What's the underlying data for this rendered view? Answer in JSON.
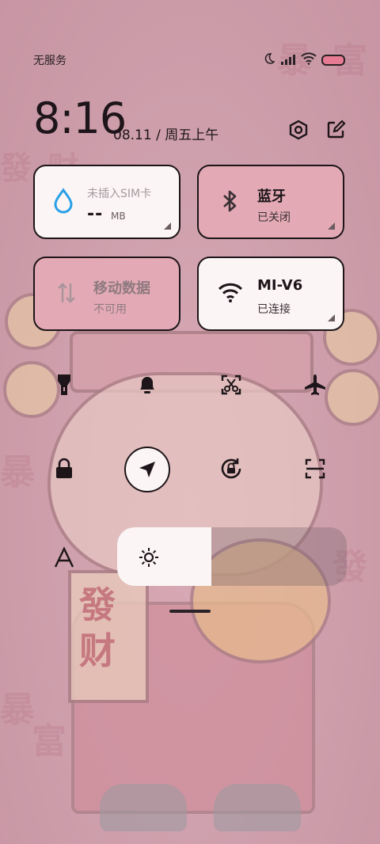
{
  "status_bar": {
    "carrier": "无服务",
    "icons": [
      "moon-icon",
      "signal-icon",
      "wifi-icon",
      "battery-icon"
    ],
    "battery_color": "#e77b93"
  },
  "header": {
    "time": "8:16",
    "date": "08.11 / 周五上午",
    "icons": [
      "settings-icon",
      "edit-icon"
    ]
  },
  "tiles": {
    "sim": {
      "label": "未插入SIM卡",
      "value": "--",
      "unit": "MB"
    },
    "bluetooth": {
      "title": "蓝牙",
      "status": "已关闭"
    },
    "mobile_data": {
      "title": "移动数据",
      "status": "不可用"
    },
    "wifi": {
      "title": "MI-V6",
      "status": "已连接"
    }
  },
  "toggles_row1": [
    "flashlight-icon",
    "bell-icon",
    "screenshot-icon",
    "airplane-icon"
  ],
  "toggles_row2": [
    "lock-icon",
    "location-icon",
    "rotation-lock-icon",
    "scan-icon"
  ],
  "brightness": {
    "level": 0.41,
    "auto_label_icon": "font-size-icon"
  },
  "colors": {
    "tile_light": "#fbf5f6",
    "tile_pink": "#e3aab5",
    "ink": "#1d1519"
  }
}
